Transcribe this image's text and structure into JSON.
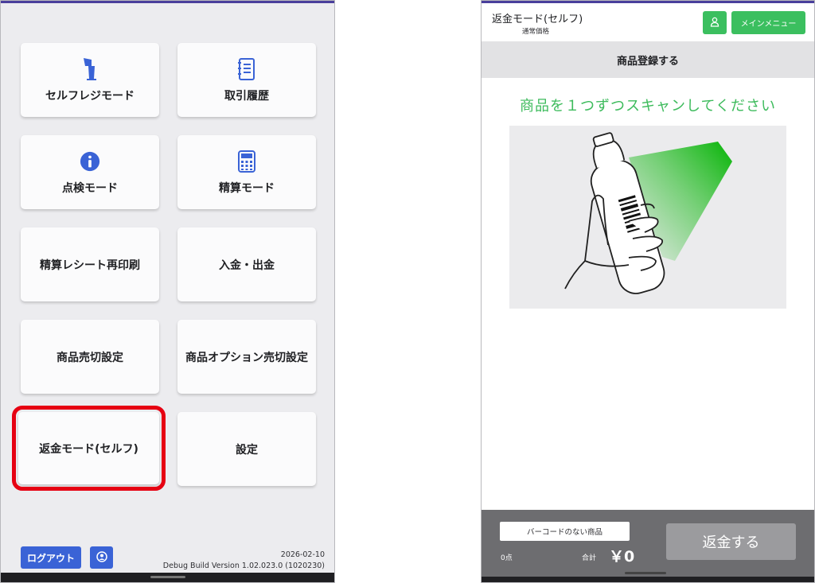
{
  "left_screen": {
    "tiles": [
      {
        "label": "セルフレジモード",
        "icon": "kiosk-icon"
      },
      {
        "label": "取引履歴",
        "icon": "notebook-icon"
      },
      {
        "label": "点検モード",
        "icon": "info-icon"
      },
      {
        "label": "精算モード",
        "icon": "calculator-icon"
      },
      {
        "label": "精算レシート再印刷",
        "icon": ""
      },
      {
        "label": "入金・出金",
        "icon": ""
      },
      {
        "label": "商品売切設定",
        "icon": ""
      },
      {
        "label": "商品オプション売切設定",
        "icon": ""
      },
      {
        "label": "返金モード(セルフ)",
        "icon": "",
        "highlighted": true
      },
      {
        "label": "設定",
        "icon": ""
      }
    ],
    "logout_label": "ログアウト",
    "date": "2026-02-10",
    "version": "Debug Build Version 1.02.023.0 (1020230)",
    "accent_color": "#3a63d6",
    "highlight_color": "#e60012"
  },
  "right_screen": {
    "mode_title": "返金モード(セルフ)",
    "price_type": "通常価格",
    "main_menu_label": "メインメニュー",
    "section_title": "商品登録する",
    "instruction": "商品を１つずつスキャンしてください",
    "no_barcode_label": "バーコードのない商品",
    "item_count": "0点",
    "total_label": "合計",
    "total_value": "￥0",
    "refund_label": "返金する",
    "accent_color": "#3bbf5f"
  }
}
